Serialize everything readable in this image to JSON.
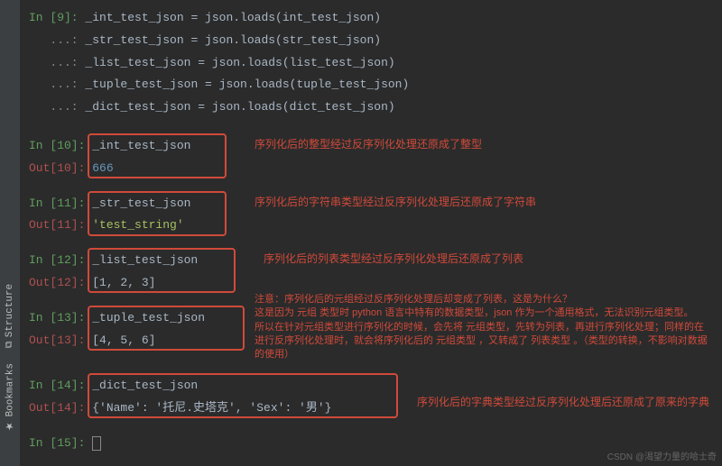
{
  "sidebar": {
    "tabs": [
      {
        "label": "Structure",
        "icon": "structure-icon"
      },
      {
        "label": "Bookmarks",
        "icon": "bookmark-icon"
      }
    ]
  },
  "cell9": {
    "prompt": "In [9]: ",
    "cont": "   ...: ",
    "lines": [
      "_int_test_json = json.loads(int_test_json)",
      "_str_test_json = json.loads(str_test_json)",
      "_list_test_json = json.loads(list_test_json)",
      "_tuple_test_json = json.loads(tuple_test_json)",
      "_dict_test_json = json.loads(dict_test_json)"
    ]
  },
  "cell10": {
    "in_prompt": "In [10]: ",
    "in_code": "_int_test_json",
    "out_prompt": "Out[10]: ",
    "out_val": "666",
    "note": "序列化后的整型经过反序列化处理还原成了整型"
  },
  "cell11": {
    "in_prompt": "In [11]: ",
    "in_code": "_str_test_json",
    "out_prompt": "Out[11]: ",
    "out_val": "'test_string'",
    "note": "序列化后的字符串类型经过反序列化处理后还原成了字符串"
  },
  "cell12": {
    "in_prompt": "In [12]: ",
    "in_code": "_list_test_json",
    "out_prompt": "Out[12]: ",
    "out_val": "[1, 2, 3]",
    "note": "序列化后的列表类型经过反序列化处理后还原成了列表"
  },
  "cell13": {
    "in_prompt": "In [13]: ",
    "in_code": "_tuple_test_json",
    "out_prompt": "Out[13]: ",
    "out_val": "[4, 5, 6]",
    "note_l1": "注意：序列化后的元组经过反序列化处理后却变成了列表，这是为什么？",
    "note_l2": "这是因为 元组 类型时 python 语言中特有的数据类型，json 作为一个通用格式，无法识别元组类型。",
    "note_l3": "所以在针对元组类型进行序列化的时候，会先将 元组类型，先转为列表，再进行序列化处理；同样的在",
    "note_l4": "进行反序列化处理时，就会将序列化后的 元组类型 ，又转成了 列表类型 。（类型的转换，不影响对数据",
    "note_l5": "的使用）"
  },
  "cell14": {
    "in_prompt": "In [14]: ",
    "in_code": "_dict_test_json",
    "out_prompt": "Out[14]: ",
    "out_val": "{'Name': '托尼.史塔克', 'Sex': '男'}",
    "note": "序列化后的字典类型经过反序列化处理后还原成了原来的字典"
  },
  "cell15": {
    "in_prompt": "In [15]: "
  },
  "watermark": "CSDN @渴望力量的哈士奇"
}
